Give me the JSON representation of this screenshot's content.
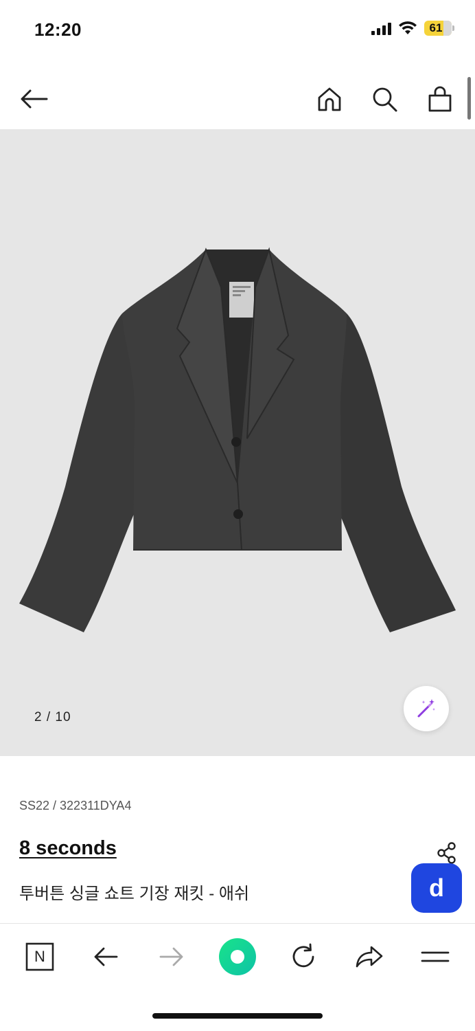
{
  "status_bar": {
    "time": "12:20",
    "battery_level": "61",
    "battery_color": "#f5d33a"
  },
  "header": {
    "icons": [
      "back-arrow-icon",
      "home-icon",
      "search-icon",
      "shopping-bag-icon"
    ]
  },
  "gallery": {
    "page_counter": "2 / 10",
    "background": "#e6e6e6",
    "product_color": "#3a3a3a"
  },
  "product": {
    "code": "SS22 / 322311DYA4",
    "brand": "8 seconds",
    "name": "투버튼 싱글 쇼트 기장 재킷 - 애쉬"
  },
  "floating": {
    "d_badge_label": "d",
    "d_badge_color": "#1f46e0"
  },
  "toolbar": {
    "n_label": "N",
    "icons": [
      "naver-n-icon",
      "back-arrow-icon",
      "forward-arrow-icon",
      "green-dot-icon",
      "refresh-icon",
      "share-arrow-icon",
      "menu-icon"
    ],
    "accent": "#10d38e"
  }
}
